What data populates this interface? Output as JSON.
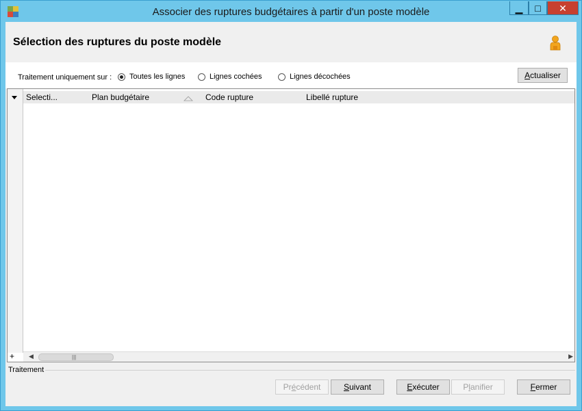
{
  "window": {
    "title": "Associer des ruptures budgétaires à partir d'un poste modèle",
    "controls": {
      "minimize": "▁",
      "maximize": "□",
      "close": "✕"
    }
  },
  "header": {
    "title": "Sélection des ruptures du poste modèle",
    "user_icon": "user-icon"
  },
  "filter": {
    "label": "Traitement uniquement sur :",
    "options": [
      {
        "label": "Toutes les lignes",
        "selected": true
      },
      {
        "label": "Lignes cochées",
        "selected": false
      },
      {
        "label": "Lignes décochées",
        "selected": false
      }
    ],
    "refresh_button": {
      "mnemonic": "A",
      "rest": "ctualiser"
    }
  },
  "grid": {
    "columns": [
      "Selecti...",
      "Plan budgétaire",
      "Code rupture",
      "Libellé rupture"
    ],
    "rows": [],
    "add_glyph": "+",
    "scroll_left": "◀",
    "scroll_right": "▶",
    "scroll_grip": "|||"
  },
  "footer": {
    "section_label": "Traitement",
    "buttons": {
      "previous": {
        "pre": "Pr",
        "mnemonic": "é",
        "rest": "cédent"
      },
      "next": {
        "pre": "",
        "mnemonic": "S",
        "rest": "uivant"
      },
      "execute": {
        "pre": "",
        "mnemonic": "E",
        "rest": "xécuter"
      },
      "schedule": {
        "pre": "P",
        "mnemonic": "l",
        "rest": "anifier"
      },
      "close": {
        "pre": "",
        "mnemonic": "F",
        "rest": "ermer"
      }
    }
  },
  "colors": {
    "title_bar": "#6fc7ea",
    "close_button": "#c7402f",
    "icon_tiles": [
      "#7aa64b",
      "#e0c23a",
      "#d84a3a",
      "#3b7fc0"
    ],
    "user_icon": "#f2a51e"
  }
}
